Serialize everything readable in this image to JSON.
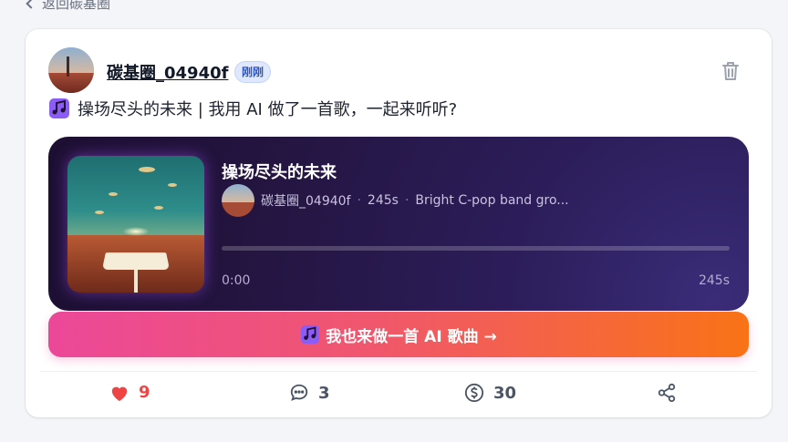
{
  "nav": {
    "back_label": "返回碳基圈"
  },
  "post": {
    "author": "碳基圈_04940f",
    "time_badge": "刚刚",
    "text": "操场尽头的未来 | 我用 AI 做了一首歌，一起来听听?"
  },
  "player": {
    "song_title": "操场尽头的未来",
    "artist": "碳基圈_04940f",
    "duration": "245s",
    "description": "Bright C-pop band gro...",
    "current_time": "0:00",
    "total_time": "245s",
    "progress": 0
  },
  "cta": {
    "label": "我也来做一首 AI 歌曲 →"
  },
  "actions": {
    "likes": "9",
    "comments": "3",
    "coins": "30"
  },
  "colors": {
    "like": "#ef4444",
    "cta_start": "#ec4899",
    "cta_end": "#f97316",
    "player_bg": "#23143f"
  }
}
